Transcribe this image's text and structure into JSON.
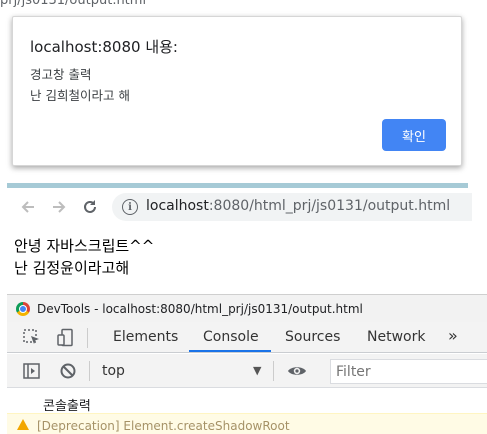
{
  "top_partial_url": "prj/js0131/output.html",
  "alert": {
    "title": "localhost:8080 내용:",
    "message_line1": "경고창 출력",
    "message_line2": "난 김희철이라고 해",
    "ok_label": "확인"
  },
  "browser": {
    "url_host": "localhost",
    "url_path": ":8080/html_prj/js0131/output.html"
  },
  "page": {
    "line1": "안녕 자바스크립트^^",
    "line2": "난 김정윤이라고해"
  },
  "devtools": {
    "window_title": "DevTools - localhost:8080/html_prj/js0131/output.html",
    "tabs": [
      "Elements",
      "Console",
      "Sources",
      "Network"
    ],
    "active_tab": "Console",
    "more_tabs": "»",
    "context": "top",
    "filter_placeholder": "Filter",
    "console_output": "콘솔출력",
    "warning_partial": "[Deprecation] Element.createShadowRoot"
  },
  "colors": {
    "accent": "#4285f4",
    "tab_underline": "#1a73e8",
    "separator": "#a6cad6"
  }
}
